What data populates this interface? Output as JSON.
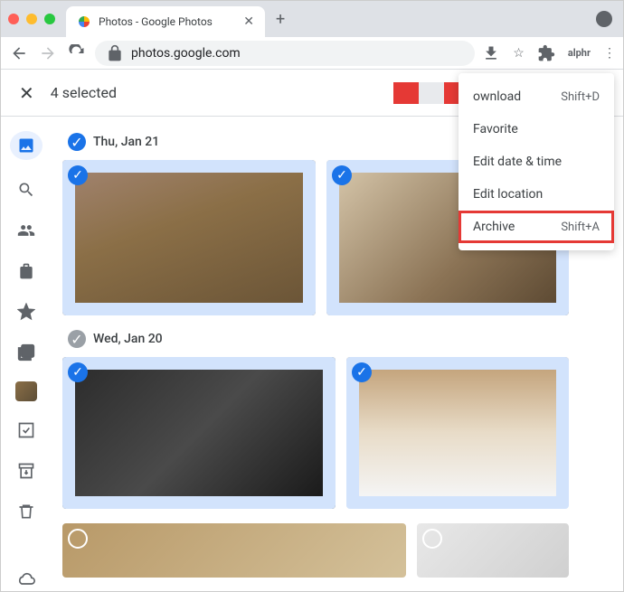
{
  "browser": {
    "tab_title": "Photos - Google Photos",
    "url": "photos.google.com",
    "ext_label": "alphr"
  },
  "selection": {
    "close": "✕",
    "text": "4 selected"
  },
  "nav": {
    "items": [
      "photos",
      "search",
      "sharing",
      "print-store",
      "favorites",
      "albums",
      "thumb",
      "utilities",
      "archive-box",
      "trash",
      "cloud"
    ]
  },
  "dates": [
    {
      "label": "Thu, Jan 21",
      "checked": "blue"
    },
    {
      "label": "Wed, Jan 20",
      "checked": "gray"
    }
  ],
  "menu": {
    "items": [
      {
        "label": "ownload",
        "shortcut": "Shift+D",
        "hl": false
      },
      {
        "label": "Favorite",
        "shortcut": "",
        "hl": false
      },
      {
        "label": "Edit date & time",
        "shortcut": "",
        "hl": false
      },
      {
        "label": "Edit location",
        "shortcut": "",
        "hl": false
      },
      {
        "label": "Archive",
        "shortcut": "Shift+A",
        "hl": true
      }
    ]
  }
}
